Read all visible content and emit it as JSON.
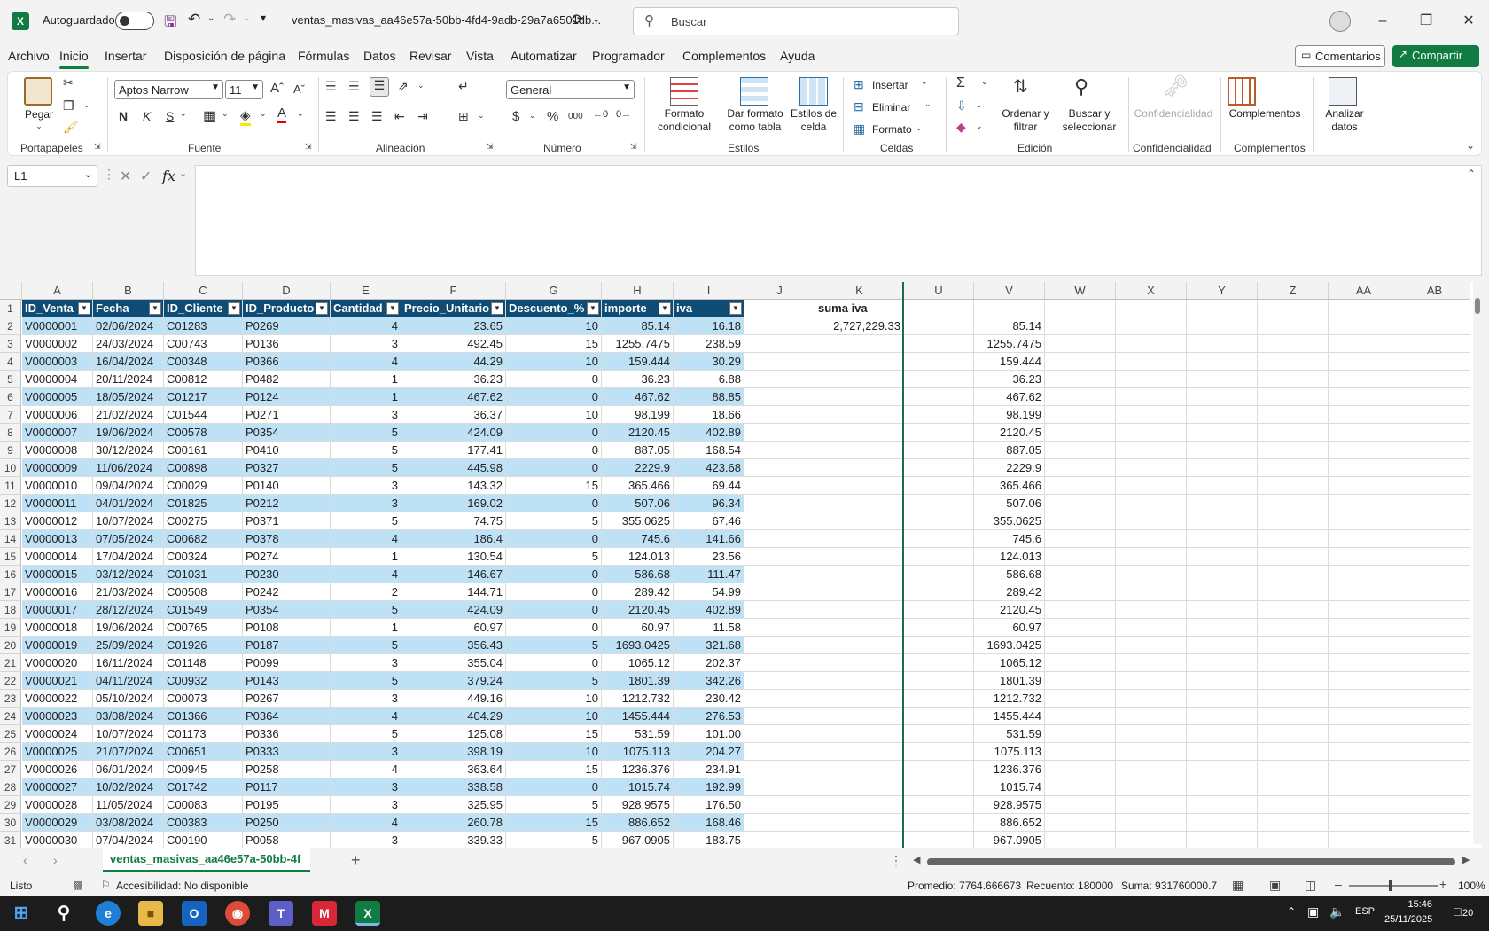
{
  "titlebar": {
    "autosave_label": "Autoguardado",
    "filename": "ventas_masivas_aa46e57a-50bb-4fd4-9adb-29a7a6501db...",
    "search_placeholder": "Buscar"
  },
  "tabs": [
    "Archivo",
    "Inicio",
    "Insertar",
    "Disposición de página",
    "Fórmulas",
    "Datos",
    "Revisar",
    "Vista",
    "Automatizar",
    "Programador",
    "Complementos",
    "Ayuda"
  ],
  "active_tab": "Inicio",
  "actions": {
    "comments": "Comentarios",
    "share": "Compartir"
  },
  "ribbon": {
    "paste": "Pegar",
    "font_name": "Aptos Narrow",
    "font_size": "11",
    "number_format": "General",
    "bold": "N",
    "italic": "K",
    "underline": "S",
    "conditional_format_1": "Formato",
    "conditional_format_2": "condicional",
    "format_table_1": "Dar formato",
    "format_table_2": "como tabla",
    "cell_styles_1": "Estilos de",
    "cell_styles_2": "celda",
    "insert": "Insertar",
    "delete": "Eliminar",
    "format": "Formato",
    "sort_1": "Ordenar y",
    "sort_2": "filtrar",
    "find_1": "Buscar y",
    "find_2": "seleccionar",
    "sensitivity": "Confidencialidad",
    "addins": "Complementos",
    "analyze_1": "Analizar",
    "analyze_2": "datos",
    "groups": {
      "clipboard": "Portapapeles",
      "font": "Fuente",
      "alignment": "Alineación",
      "number": "Número",
      "styles": "Estilos",
      "cells": "Celdas",
      "editing": "Edición",
      "sensitivity": "Confidencialidad",
      "addins": "Complementos"
    }
  },
  "formula_bar": {
    "name_box": "L1",
    "fx": "fx",
    "content": ""
  },
  "columns": [
    "A",
    "B",
    "C",
    "D",
    "E",
    "F",
    "G",
    "H",
    "I",
    "J",
    "K",
    "U",
    "V",
    "W",
    "X",
    "Y",
    "Z",
    "AA",
    "AB"
  ],
  "table_headers": [
    "ID_Venta",
    "Fecha",
    "ID_Cliente",
    "ID_Producto",
    "Cantidad",
    "Precio_Unitario",
    "Descuento_%",
    "importe",
    "iva"
  ],
  "k_label": "suma iva",
  "k_value": "2,727,229.33",
  "rows": [
    [
      "V0000001",
      "02/06/2024",
      "C01283",
      "P0269",
      "4",
      "23.65",
      "10",
      "85.14",
      "16.18",
      "85.14"
    ],
    [
      "V0000002",
      "24/03/2024",
      "C00743",
      "P0136",
      "3",
      "492.45",
      "15",
      "1255.7475",
      "238.59",
      "1255.7475"
    ],
    [
      "V0000003",
      "16/04/2024",
      "C00348",
      "P0366",
      "4",
      "44.29",
      "10",
      "159.444",
      "30.29",
      "159.444"
    ],
    [
      "V0000004",
      "20/11/2024",
      "C00812",
      "P0482",
      "1",
      "36.23",
      "0",
      "36.23",
      "6.88",
      "36.23"
    ],
    [
      "V0000005",
      "18/05/2024",
      "C01217",
      "P0124",
      "1",
      "467.62",
      "0",
      "467.62",
      "88.85",
      "467.62"
    ],
    [
      "V0000006",
      "21/02/2024",
      "C01544",
      "P0271",
      "3",
      "36.37",
      "10",
      "98.199",
      "18.66",
      "98.199"
    ],
    [
      "V0000007",
      "19/06/2024",
      "C00578",
      "P0354",
      "5",
      "424.09",
      "0",
      "2120.45",
      "402.89",
      "2120.45"
    ],
    [
      "V0000008",
      "30/12/2024",
      "C00161",
      "P0410",
      "5",
      "177.41",
      "0",
      "887.05",
      "168.54",
      "887.05"
    ],
    [
      "V0000009",
      "11/06/2024",
      "C00898",
      "P0327",
      "5",
      "445.98",
      "0",
      "2229.9",
      "423.68",
      "2229.9"
    ],
    [
      "V0000010",
      "09/04/2024",
      "C00029",
      "P0140",
      "3",
      "143.32",
      "15",
      "365.466",
      "69.44",
      "365.466"
    ],
    [
      "V0000011",
      "04/01/2024",
      "C01825",
      "P0212",
      "3",
      "169.02",
      "0",
      "507.06",
      "96.34",
      "507.06"
    ],
    [
      "V0000012",
      "10/07/2024",
      "C00275",
      "P0371",
      "5",
      "74.75",
      "5",
      "355.0625",
      "67.46",
      "355.0625"
    ],
    [
      "V0000013",
      "07/05/2024",
      "C00682",
      "P0378",
      "4",
      "186.4",
      "0",
      "745.6",
      "141.66",
      "745.6"
    ],
    [
      "V0000014",
      "17/04/2024",
      "C00324",
      "P0274",
      "1",
      "130.54",
      "5",
      "124.013",
      "23.56",
      "124.013"
    ],
    [
      "V0000015",
      "03/12/2024",
      "C01031",
      "P0230",
      "4",
      "146.67",
      "0",
      "586.68",
      "111.47",
      "586.68"
    ],
    [
      "V0000016",
      "21/03/2024",
      "C00508",
      "P0242",
      "2",
      "144.71",
      "0",
      "289.42",
      "54.99",
      "289.42"
    ],
    [
      "V0000017",
      "28/12/2024",
      "C01549",
      "P0354",
      "5",
      "424.09",
      "0",
      "2120.45",
      "402.89",
      "2120.45"
    ],
    [
      "V0000018",
      "19/06/2024",
      "C00765",
      "P0108",
      "1",
      "60.97",
      "0",
      "60.97",
      "11.58",
      "60.97"
    ],
    [
      "V0000019",
      "25/09/2024",
      "C01926",
      "P0187",
      "5",
      "356.43",
      "5",
      "1693.0425",
      "321.68",
      "1693.0425"
    ],
    [
      "V0000020",
      "16/11/2024",
      "C01148",
      "P0099",
      "3",
      "355.04",
      "0",
      "1065.12",
      "202.37",
      "1065.12"
    ],
    [
      "V0000021",
      "04/11/2024",
      "C00932",
      "P0143",
      "5",
      "379.24",
      "5",
      "1801.39",
      "342.26",
      "1801.39"
    ],
    [
      "V0000022",
      "05/10/2024",
      "C00073",
      "P0267",
      "3",
      "449.16",
      "10",
      "1212.732",
      "230.42",
      "1212.732"
    ],
    [
      "V0000023",
      "03/08/2024",
      "C01366",
      "P0364",
      "4",
      "404.29",
      "10",
      "1455.444",
      "276.53",
      "1455.444"
    ],
    [
      "V0000024",
      "10/07/2024",
      "C01173",
      "P0336",
      "5",
      "125.08",
      "15",
      "531.59",
      "101.00",
      "531.59"
    ],
    [
      "V0000025",
      "21/07/2024",
      "C00651",
      "P0333",
      "3",
      "398.19",
      "10",
      "1075.113",
      "204.27",
      "1075.113"
    ],
    [
      "V0000026",
      "06/01/2024",
      "C00945",
      "P0258",
      "4",
      "363.64",
      "15",
      "1236.376",
      "234.91",
      "1236.376"
    ],
    [
      "V0000027",
      "10/02/2024",
      "C01742",
      "P0117",
      "3",
      "338.58",
      "0",
      "1015.74",
      "192.99",
      "1015.74"
    ],
    [
      "V0000028",
      "11/05/2024",
      "C00083",
      "P0195",
      "3",
      "325.95",
      "5",
      "928.9575",
      "176.50",
      "928.9575"
    ],
    [
      "V0000029",
      "03/08/2024",
      "C00383",
      "P0250",
      "4",
      "260.78",
      "15",
      "886.652",
      "168.46",
      "886.652"
    ],
    [
      "V0000030",
      "07/04/2024",
      "C00190",
      "P0058",
      "3",
      "339.33",
      "5",
      "967.0905",
      "183.75",
      "967.0905"
    ]
  ],
  "sheet_tab": "ventas_masivas_aa46e57a-50bb-4f",
  "status": {
    "ready": "Listo",
    "accessibility": "Accesibilidad: No disponible",
    "average": "Promedio: 7764.666673",
    "count": "Recuento: 180000",
    "sum": "Suma: 931760000.7",
    "zoom": "100%"
  },
  "taskbar": {
    "lang": "ESP",
    "time": "15:46",
    "date": "25/11/2025",
    "notif": "20"
  },
  "colors": {
    "excel_green": "#107c41",
    "table_header": "#0e4c75",
    "band": "#bfe1f5"
  }
}
